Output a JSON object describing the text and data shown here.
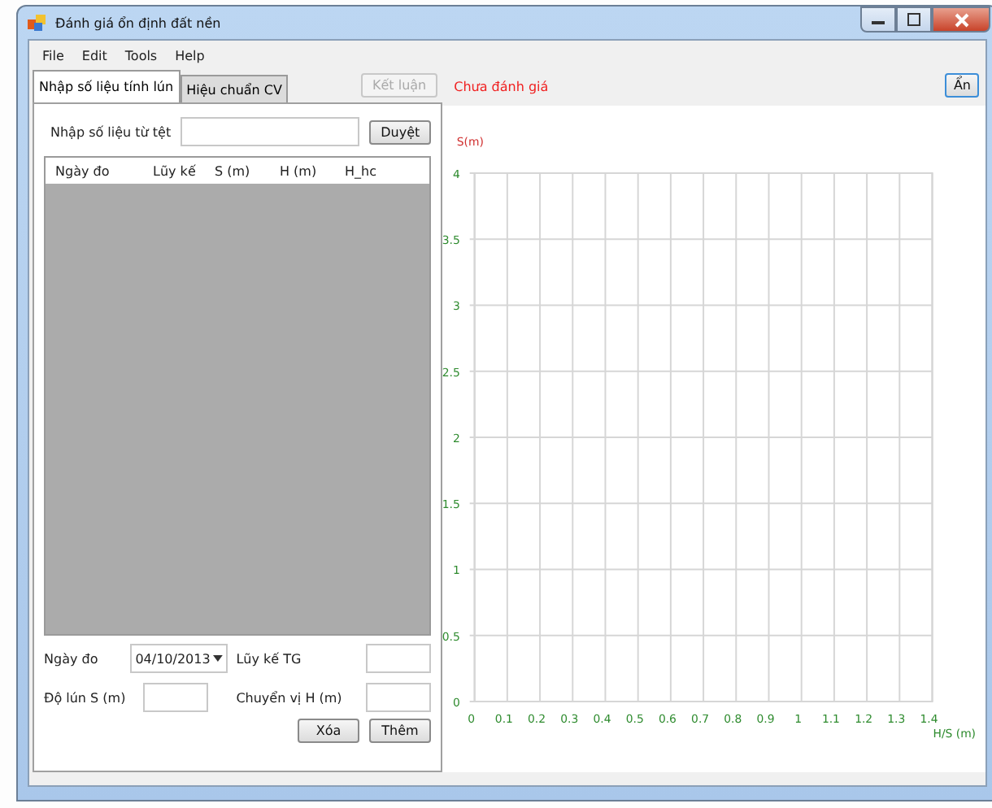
{
  "window": {
    "title": "Đánh giá ổn định đất nền"
  },
  "menu": [
    "File",
    "Edit",
    "Tools",
    "Help"
  ],
  "tabs": [
    {
      "label": "Nhập số liệu tính lún",
      "selected": true
    },
    {
      "label": "Hiệu chuẩn CV",
      "selected": false
    }
  ],
  "conclude_button": {
    "label": "Kết luận",
    "disabled": true
  },
  "status": "Chưa đánh giá",
  "hide_button": {
    "label": "Ẩn"
  },
  "import": {
    "label": "Nhập số liệu từ tệt",
    "button": "Duyệt"
  },
  "table": {
    "columns": [
      "Ngày đo",
      "Lũy kế",
      "S (m)",
      "H (m)",
      "H_hc"
    ]
  },
  "form": {
    "date_label": "Ngày đo",
    "date_value": "04/10/2013",
    "cumulative_label": "Lũy kế TG",
    "settlement_label": "Độ lún S (m)",
    "displacement_label": "Chuyển vị H (m)"
  },
  "buttons": [
    "Xóa",
    "Thêm"
  ],
  "chart": {
    "chart_data": {
      "type": "line",
      "grid": true,
      "ylabel": "S(m)",
      "xlabel": "H/S (m)",
      "xlim": [
        0,
        1.4
      ],
      "ylim": [
        0,
        4
      ],
      "xticks": [
        0,
        0.1,
        0.2,
        0.3,
        0.4,
        0.5,
        0.6,
        0.7,
        0.8,
        0.9,
        1,
        1.1,
        1.2,
        1.3,
        1.4
      ],
      "yticks": [
        0,
        0.5,
        1,
        1.5,
        2,
        2.5,
        3,
        3.5,
        4
      ]
    }
  }
}
